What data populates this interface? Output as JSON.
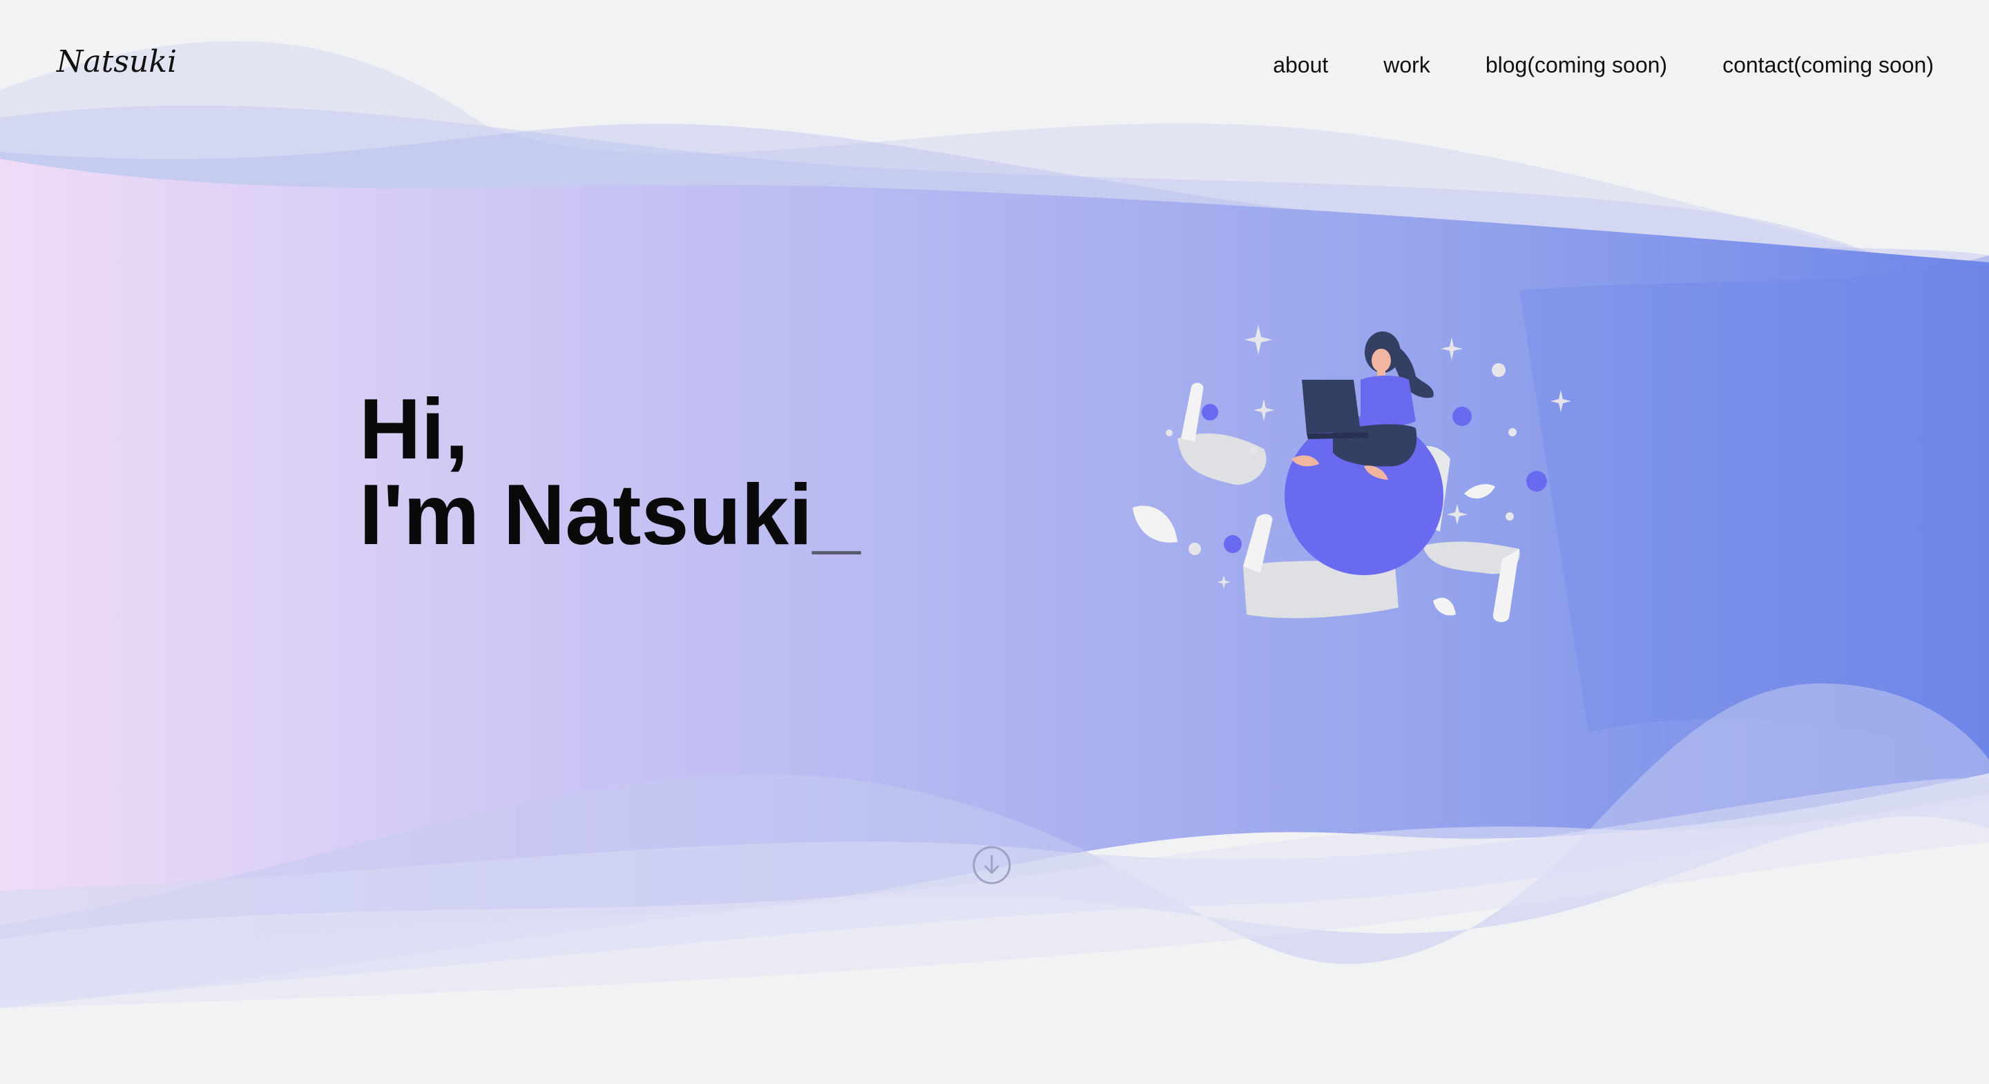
{
  "header": {
    "logo": "Natsuki",
    "nav": [
      {
        "label": "about"
      },
      {
        "label": "work"
      },
      {
        "label": "blog(coming soon)"
      },
      {
        "label": "contact(coming soon)"
      }
    ]
  },
  "hero": {
    "line1": "Hi,",
    "line2": "I'm Natsuki",
    "cursor": "_"
  },
  "icons": {
    "scroll": "arrow-down-circle-icon"
  },
  "colors": {
    "background": "#f1f2f4",
    "gradient_start": "#efdcf7",
    "gradient_mid": "#b8b8f2",
    "gradient_end": "#6e86e8",
    "illustration_accent": "#6a6af0",
    "illustration_dark": "#333f63"
  }
}
